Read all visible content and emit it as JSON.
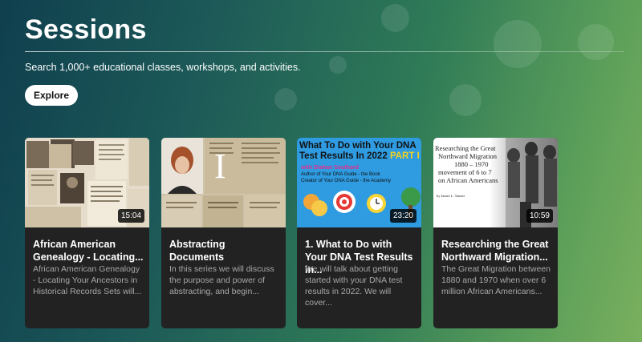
{
  "header": {
    "title": "Sessions",
    "subtitle": "Search 1,000+ educational classes, workshops, and activities.",
    "explore_label": "Explore"
  },
  "cards": [
    {
      "duration": "15:04",
      "title": "African American Genealogy - Locating...",
      "description": "African American Genealogy - Locating Your Ancestors in Historical Records Sets will..."
    },
    {
      "duration": "",
      "title": "Abstracting Documents",
      "description": "In this series we will discuss the purpose and power of abstracting, and begin...",
      "thumb_letter": "I"
    },
    {
      "duration": "23:20",
      "title": "1. What to Do with Your DNA Test Results in...",
      "description": "We will talk about getting started with your DNA test results in 2022. We will cover...",
      "thumb_heading": "What To Do with Your DNA Test Results In 2022",
      "thumb_part": "PART I",
      "thumb_author": "with Diahan Southard",
      "thumb_line1": "Author of Your DNA Guide - the Book",
      "thumb_line2": "Creator of Your DNA Guide - the Academy"
    },
    {
      "duration": "10:59",
      "title": "Researching the Great Northward Migration...",
      "description": "The Great Migration between 1880 and 1970 when over 6 million African Americans...",
      "thumb_text": [
        "Researching the Great",
        "Northward Migration",
        "1880 – 1970",
        "movement of 6 to 7",
        "on African Americans"
      ],
      "thumb_byline": "by James L. Tanner"
    }
  ]
}
